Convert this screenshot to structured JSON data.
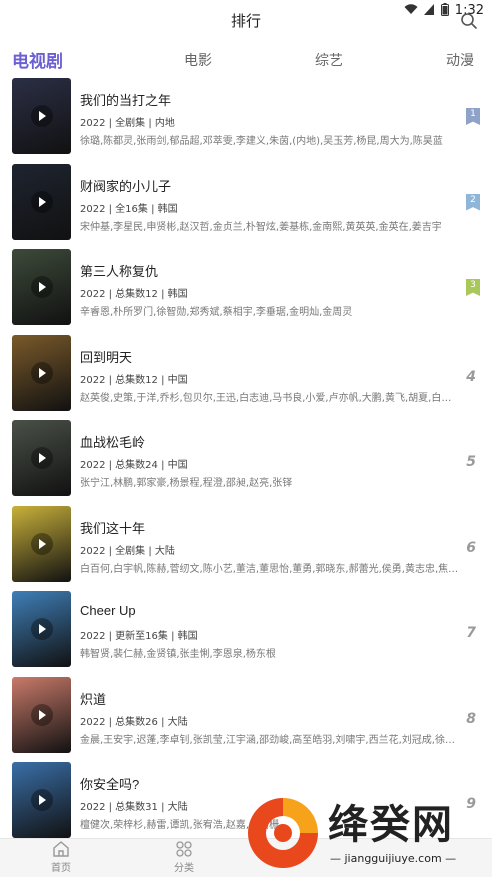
{
  "status": {
    "time": "1:32"
  },
  "header": {
    "title": "排行"
  },
  "tabs": [
    {
      "label": "电视剧"
    },
    {
      "label": "电影"
    },
    {
      "label": "综艺"
    },
    {
      "label": "动漫"
    }
  ],
  "items": [
    {
      "title": "我们的当打之年",
      "meta": "2022 | 全剧集 | 内地",
      "cast": "徐璐,陈都灵,张雨剑,郁品超,邓萃雯,李建义,朱茵,(内地),吴玉芳,杨昆,周大为,陈昊蓝",
      "rank": "1",
      "poster_color": "#2b2f45",
      "badge_color": "#8fa3c9"
    },
    {
      "title": "财阀家的小儿子",
      "meta": "2022 | 全16集 | 韩国",
      "cast": "宋仲基,李星民,申贤彬,赵汉哲,金贞兰,朴智炫,姜基栋,金南熙,黄英英,金英在,姜吉宇",
      "rank": "2",
      "poster_color": "#1e2430",
      "badge_color": "#8fb5d9"
    },
    {
      "title": "第三人称复仇",
      "meta": "2022 | 总集数12 | 韩国",
      "cast": "辛睿恩,朴所罗门,徐智勋,郑秀斌,蔡相宇,李垂琚,金明灿,金周灵",
      "rank": "3",
      "poster_color": "#3d4a3a",
      "badge_color": "#a9c85c"
    },
    {
      "title": "回到明天",
      "meta": "2022 | 总集数12 | 中国",
      "cast": "赵英俊,史策,于洋,乔杉,包贝尔,王迅,白志迪,马书良,小爱,卢亦帆,大鹏,黄飞,胡夏,白客,崔志佳",
      "rank": "4",
      "poster_color": "#7a5a2a",
      "badge_color": ""
    },
    {
      "title": "血战松毛岭",
      "meta": "2022 | 总集数24 | 中国",
      "cast": "张宁江,林鹏,郭家豪,杨景程,程澄,邵昶,赵亮,张铎",
      "rank": "5",
      "poster_color": "#4a5148",
      "badge_color": ""
    },
    {
      "title": "我们这十年",
      "meta": "2022 | 全剧集 | 大陆",
      "cast": "白百何,白宇帆,陈赫,菅纫文,陈小艺,董洁,董思怡,董勇,郭晓东,郝蕾光,侯勇,黄志忠,焦俊艳,景甜",
      "rank": "6",
      "poster_color": "#c9b13a",
      "badge_color": ""
    },
    {
      "title": "Cheer Up",
      "meta": "2022 | 更新至16集 | 韩国",
      "cast": "韩智贤,裴仁赫,金贤镇,张圭悧,李恩泉,杨东根",
      "rank": "7",
      "poster_color": "#3f7fb8",
      "badge_color": ""
    },
    {
      "title": "炽道",
      "meta": "2022 | 总集数26 | 大陆",
      "cast": "金晨,王安宇,迟蓬,李卓钊,张凯莹,江宇涵,邵劲峻,高至皓羽,刘啸宇,西兰花,刘冠成,徐洁儿",
      "rank": "8",
      "poster_color": "#c97a6a",
      "badge_color": ""
    },
    {
      "title": "你安全吗?",
      "meta": "2022 | 总集数31 | 大陆",
      "cast": "檀健次,荣梓杉,赫雷,谭凯,张宥浩,赵嘉,曲栅栅",
      "rank": "9",
      "poster_color": "#3a6fa8",
      "badge_color": ""
    }
  ],
  "bottom_nav": [
    {
      "label": "首页",
      "icon": "home-icon"
    },
    {
      "label": "分类",
      "icon": "grid-icon"
    }
  ],
  "watermark": {
    "title": "绛癸网",
    "url": "jiangguijiuye.com"
  }
}
